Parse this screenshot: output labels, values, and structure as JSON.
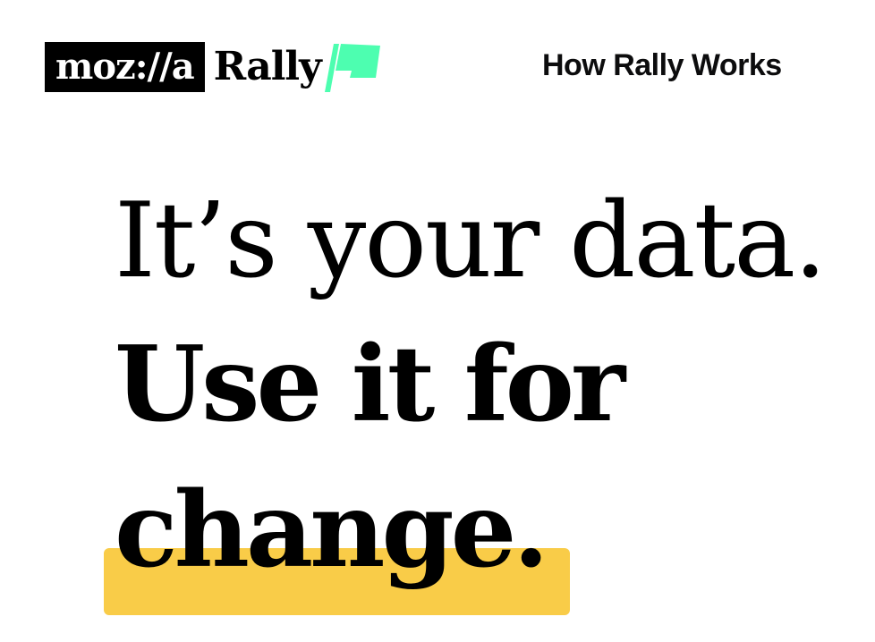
{
  "header": {
    "logo": {
      "mozilla_text": "moz://a",
      "product_text": "Rally",
      "flag_icon": "flag-icon",
      "flag_color": "#4dfeb0"
    },
    "nav": {
      "how_it_works_label": "How Rally Works"
    }
  },
  "hero": {
    "line1": "It’s your data.",
    "line2": "Use it for",
    "line3": "change.",
    "highlight_color": "#f9cc48"
  }
}
